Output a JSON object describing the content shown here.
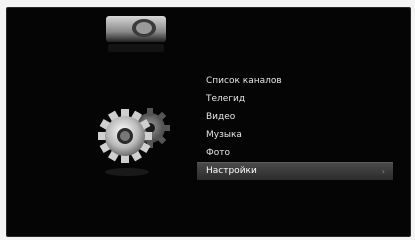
{
  "menu": {
    "items": [
      {
        "label": "Список каналов",
        "selected": false
      },
      {
        "label": "Телегид",
        "selected": false
      },
      {
        "label": "Видео",
        "selected": false
      },
      {
        "label": "Музыка",
        "selected": false
      },
      {
        "label": "Фото",
        "selected": false
      },
      {
        "label": "Настройки",
        "selected": true
      }
    ],
    "selected_indicator": "chevron-right-icon"
  },
  "icons": {
    "top": "media-device-icon",
    "main": "settings-gears-icon"
  },
  "colors": {
    "screen_background": "#050505",
    "page_background": "#f4f4f4",
    "menu_text": "#e6e6e6",
    "selected_bar": "#3a3a3a"
  }
}
